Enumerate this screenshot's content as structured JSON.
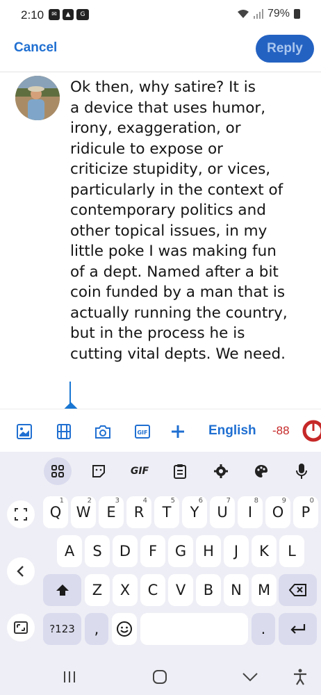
{
  "status_bar": {
    "time": "2:10",
    "battery": "79%",
    "icons": [
      "gmail-icon",
      "photo-icon",
      "sim-icon",
      "wifi-icon",
      "signal-icon",
      "battery-icon"
    ]
  },
  "header": {
    "cancel_label": "Cancel",
    "reply_label": "Reply"
  },
  "compose": {
    "text": "Ok then, why satire? It is\na device that uses humor,\nirony, exaggeration, or\nridicule to expose or\ncriticize stupidity, or vices,\nparticularly in the context of\ncontemporary politics and\nother topical issues, in my\nlittle poke I was making fun\nof a dept. Named after a bit\ncoin funded by a man that is\nactually running the country,\nbut in the process he is\ncutting vital depts. We need."
  },
  "toolbar": {
    "language": "English",
    "char_count": "-88",
    "icons": [
      "image-icon",
      "video-icon",
      "camera-icon",
      "gif-icon",
      "plus-icon"
    ]
  },
  "keyboard": {
    "top_row": {
      "gif_label": "GIF"
    },
    "row1": [
      {
        "key": "Q",
        "hint": "1"
      },
      {
        "key": "W",
        "hint": "2"
      },
      {
        "key": "E",
        "hint": "3"
      },
      {
        "key": "R",
        "hint": "4"
      },
      {
        "key": "T",
        "hint": "5"
      },
      {
        "key": "Y",
        "hint": "6"
      },
      {
        "key": "U",
        "hint": "7"
      },
      {
        "key": "I",
        "hint": "8"
      },
      {
        "key": "O",
        "hint": "9"
      },
      {
        "key": "P",
        "hint": "0"
      }
    ],
    "row2": [
      "A",
      "S",
      "D",
      "F",
      "G",
      "H",
      "J",
      "K",
      "L"
    ],
    "row3": [
      "Z",
      "X",
      "C",
      "V",
      "B",
      "N",
      "M"
    ],
    "symbols_label": "?123",
    "comma_label": ",",
    "period_label": "."
  },
  "colors": {
    "accent": "#1f6fd1",
    "reply_bg": "#2462c2",
    "over_limit": "#c62828",
    "keyboard_bg": "#eeeef6"
  }
}
